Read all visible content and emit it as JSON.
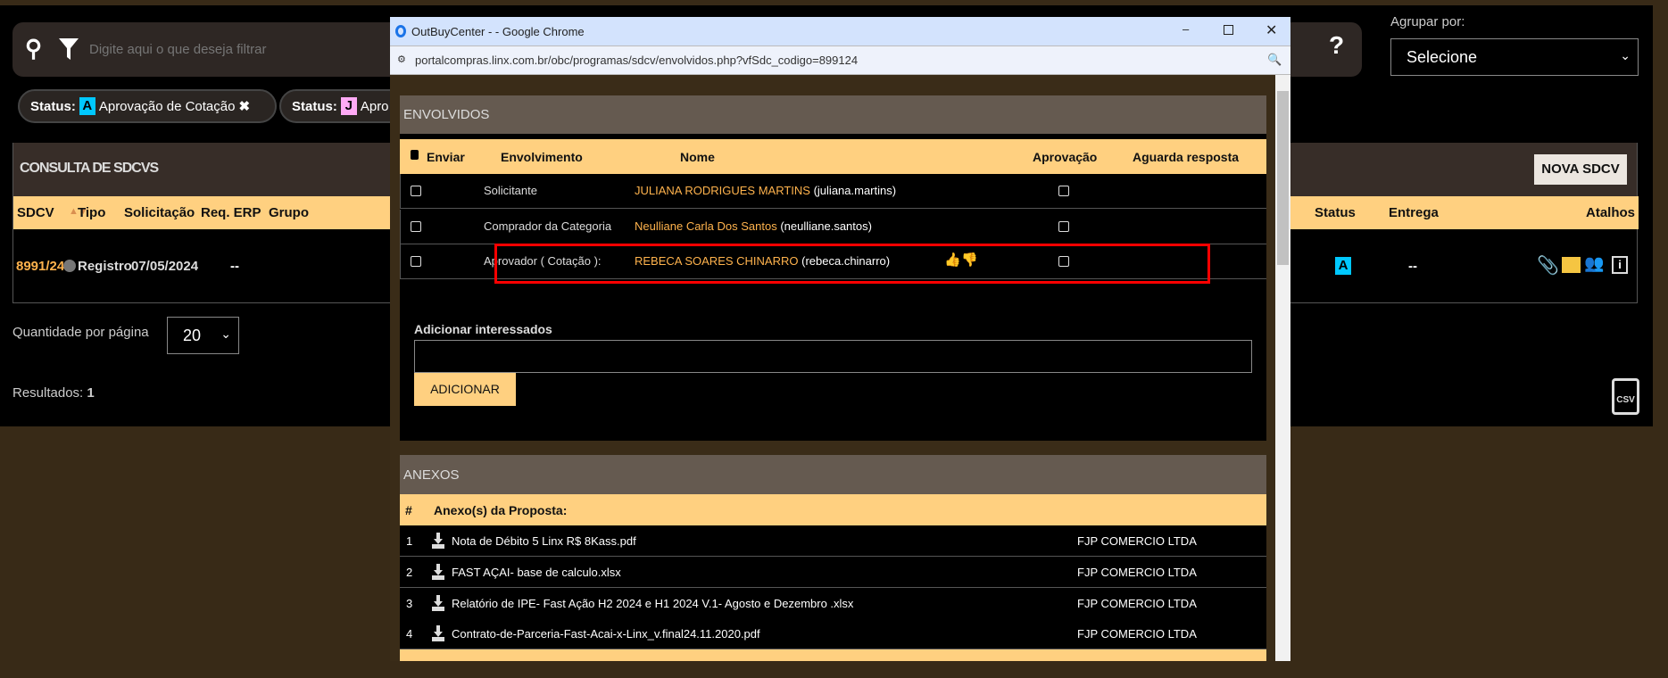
{
  "search": {
    "placeholder": "Digite aqui o que deseja filtrar"
  },
  "filters": [
    {
      "label": "Status:",
      "badge": "A",
      "badge_color": "#00c8ff",
      "text": "Aprovação de Cotação"
    },
    {
      "label": "Status:",
      "badge": "J",
      "badge_color": "#ffaaf5",
      "text": "Apro"
    }
  ],
  "group_by": {
    "label": "Agrupar por:",
    "value": "Selecione"
  },
  "panel": {
    "title": "CONSULTA DE SDCVS",
    "new_button": "NOVA SDCV",
    "columns": [
      "SDCV",
      "Tipo",
      "Solicitação",
      "Req. ERP",
      "Grupo",
      "Status",
      "Entrega",
      "Atalhos"
    ],
    "row": {
      "sdcv": "8991/24",
      "tipo": "Registro",
      "solicitacao": "07/05/2024",
      "req_erp": "--",
      "status": "A",
      "entrega": "--"
    }
  },
  "per_page": {
    "label": "Quantidade por página",
    "value": "20"
  },
  "results": {
    "label": "Resultados:",
    "count": "1"
  },
  "csv_label": "CSV",
  "popup": {
    "title": "OutBuyCenter - - Google Chrome",
    "url": "portalcompras.linx.com.br/obc/programas/sdcv/envolvidos.php?vfSdc_codigo=899124",
    "envolvidos": {
      "title": "ENVOLVIDOS",
      "columns": [
        "Enviar",
        "Envolvimento",
        "Nome",
        "Aprovação",
        "Aguarda resposta"
      ],
      "rows": [
        {
          "role": "Solicitante",
          "name": "JULIANA RODRIGUES MARTINS",
          "login": "(juliana.martins)"
        },
        {
          "role": "Comprador da Categoria",
          "name": "Neulliane Carla Dos Santos",
          "login": "(neulliane.santos)"
        },
        {
          "role": "Aprovador ( Cotação ):",
          "name": "REBECA SOARES CHINARRO",
          "login": "(rebeca.chinarro)"
        }
      ],
      "add_label": "Adicionar interessados",
      "add_value": "",
      "add_button": "ADICIONAR"
    },
    "anexos": {
      "title": "ANEXOS",
      "hash": "#",
      "header": "Anexo(s) da Proposta:",
      "rows": [
        {
          "n": "1",
          "file": "Nota de Débito 5 Linx R$ 8Kass.pdf",
          "company": "FJP COMERCIO LTDA"
        },
        {
          "n": "2",
          "file": "FAST AÇAI- base de calculo.xlsx",
          "company": "FJP COMERCIO LTDA"
        },
        {
          "n": "3",
          "file": "Relatório de IPE- Fast Ação H2 2024 e H1 2024 V.1- Agosto e Dezembro .xlsx",
          "company": "FJP COMERCIO LTDA"
        },
        {
          "n": "4",
          "file": "Contrato-de-Parceria-Fast-Acai-x-Linx_v.final24.11.2020.pdf",
          "company": "FJP COMERCIO LTDA"
        }
      ]
    }
  },
  "colors": {
    "accent": "#ffd080",
    "orange": "#ffb34d",
    "highlight": "#ff0000"
  }
}
